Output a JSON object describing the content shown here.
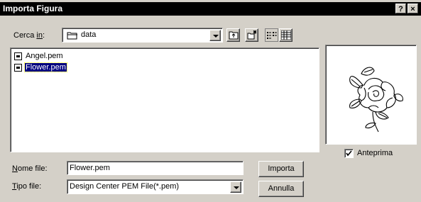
{
  "window": {
    "title": "Importa Figura",
    "help_button": "?",
    "close_button": "×"
  },
  "look_in": {
    "label_prefix": "Cerca ",
    "label_underlined": "in",
    "label_suffix": ":",
    "folder": "data",
    "folder_icon": "folder-icon"
  },
  "toolbar": {
    "icons": [
      "up-one-level-icon",
      "new-folder-icon",
      "list-view-icon",
      "details-view-icon"
    ]
  },
  "files": [
    {
      "name": "Angel.pem",
      "selected": false,
      "icon": "file-icon"
    },
    {
      "name": "Flower.pem",
      "selected": true,
      "icon": "file-icon"
    }
  ],
  "preview": {
    "image": "rose-drawing",
    "checkbox_label": "Anteprima",
    "checked": true
  },
  "filename": {
    "label_underlined": "N",
    "label_rest": "ome file:",
    "value": "Flower.pem"
  },
  "filetype": {
    "label_underlined": "T",
    "label_rest": "ipo file:",
    "value": "Design Center PEM File(*.pem)"
  },
  "buttons": {
    "import": "Importa",
    "cancel": "Annulla"
  }
}
